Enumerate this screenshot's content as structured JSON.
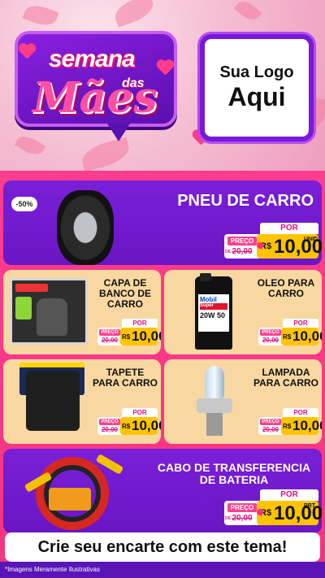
{
  "header": {
    "logo": {
      "semana": "semana",
      "das": "das",
      "maes": "Mães"
    },
    "sua_logo": {
      "line1": "Sua Logo",
      "line2": "Aqui"
    }
  },
  "products": [
    {
      "name": "PNEU DE CARRO",
      "discount": "-50%",
      "preco_label": "PREÇO",
      "de": "DE",
      "old_price": "20,00",
      "por": "POR",
      "rs": "R$",
      "price": "10,00",
      "unit": "UNID"
    },
    {
      "name": "CAPA DE BANCO DE CARRO",
      "preco_label": "PREÇO",
      "old_price": "20,00",
      "por": "POR",
      "rs": "R$",
      "price": "10,00"
    },
    {
      "name": "OLEO PARA CARRO",
      "preco_label": "PREÇO",
      "old_price": "20,00",
      "por": "POR",
      "rs": "R$",
      "price": "10,00",
      "image_text": {
        "brand": "Mobil",
        "sub": "Super",
        "grade": "20W 50"
      }
    },
    {
      "name": "TAPETE PARA CARRO",
      "preco_label": "PREÇO",
      "old_price": "20,00",
      "por": "POR",
      "rs": "R$",
      "price": "10,00"
    },
    {
      "name": "LAMPADA PARA CARRO",
      "preco_label": "PREÇO",
      "old_price": "20,00",
      "por": "POR",
      "rs": "R$",
      "price": "10,00"
    },
    {
      "name": "CABO DE TRANSFERENCIA DE BATERIA",
      "preco_label": "PREÇO",
      "de": "DE",
      "old_price": "20,00",
      "por": "POR",
      "rs": "R$",
      "price": "10,00",
      "unit": "PRT"
    }
  ],
  "cta": "Crie seu encarte com este tema!",
  "footer_note": "*Imagens Meramente Ilustrativas",
  "colors": {
    "purple": "#7a1fd8",
    "pink": "#ff3d8f",
    "peach": "#f9d7a0",
    "yellow": "#ffc400"
  }
}
